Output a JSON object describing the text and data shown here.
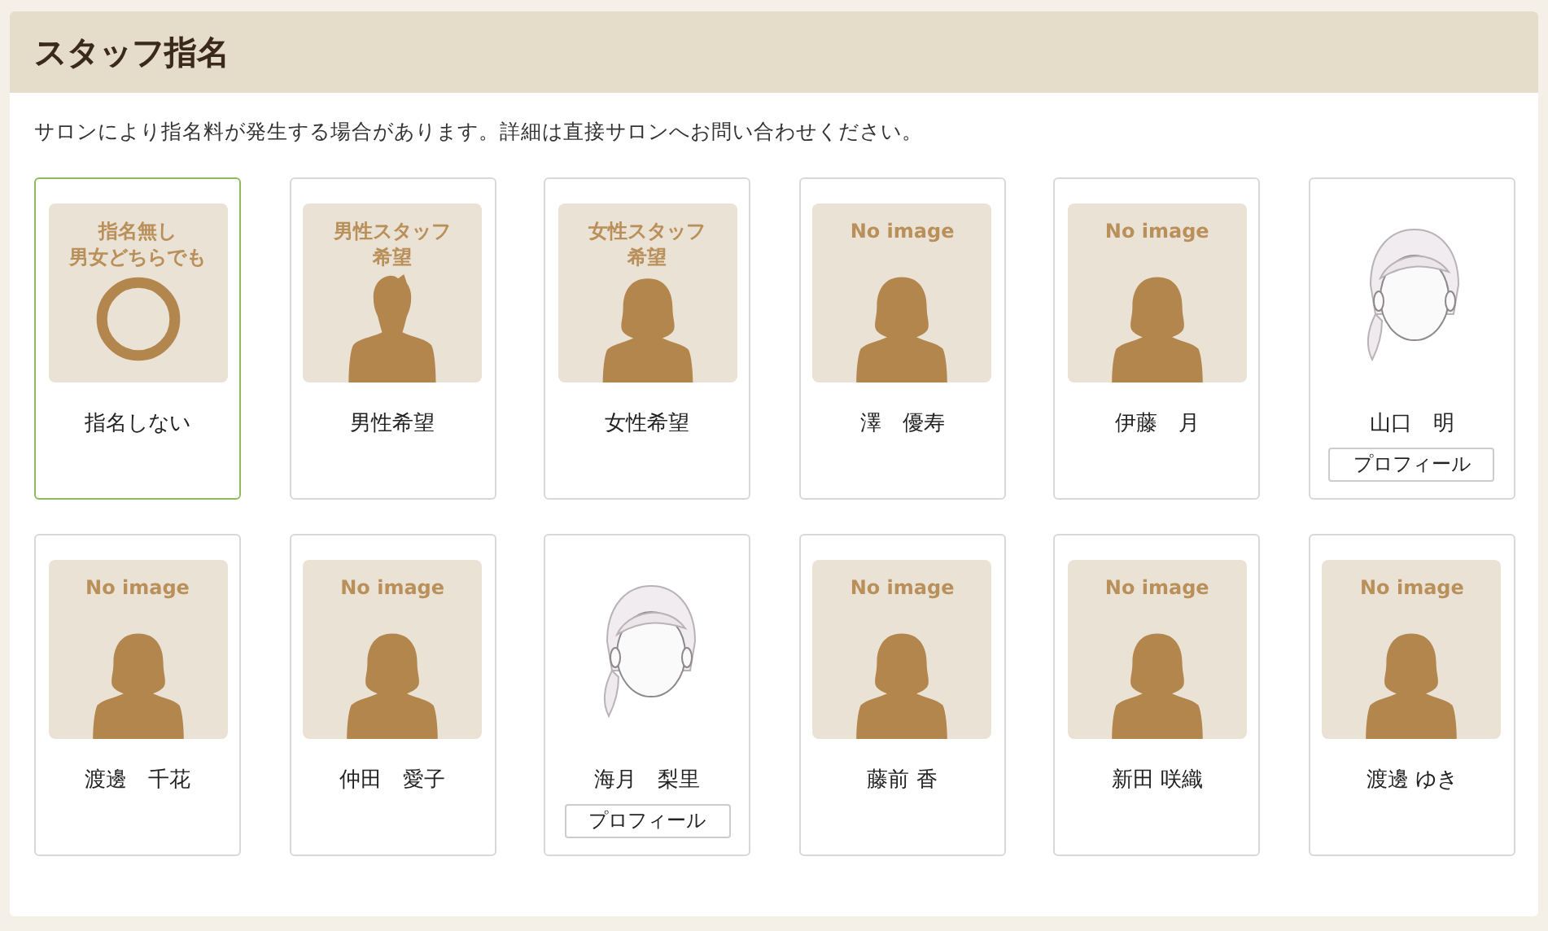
{
  "title": "スタッフ指名",
  "notice": "サロンにより指名料が発生する場合があります。詳細は直接サロンへお問い合わせください。",
  "staff": [
    {
      "image": {
        "kind": "ring",
        "text": [
          "指名無し",
          "男女どちらでも"
        ]
      },
      "name": "指名しない",
      "selected": true
    },
    {
      "image": {
        "kind": "male",
        "text": [
          "男性スタッフ",
          "希望"
        ]
      },
      "name": "男性希望",
      "selected": false
    },
    {
      "image": {
        "kind": "female",
        "text": [
          "女性スタッフ",
          "希望"
        ]
      },
      "name": "女性希望",
      "selected": false
    },
    {
      "image": {
        "kind": "female",
        "text": [
          "No image"
        ]
      },
      "name": "澤　優寿",
      "selected": false
    },
    {
      "image": {
        "kind": "female",
        "text": [
          "No image"
        ]
      },
      "name": "伊藤　月",
      "selected": false
    },
    {
      "name": "山口　明",
      "profile_button": "プロフィール",
      "selected": false
    },
    {
      "image": {
        "kind": "female",
        "text": [
          "No image"
        ]
      },
      "name": "渡邊　千花",
      "selected": false
    },
    {
      "image": {
        "kind": "female",
        "text": [
          "No image"
        ]
      },
      "name": "仲田　愛子",
      "selected": false
    },
    {
      "name": "海月　梨里",
      "profile_button": "プロフィール",
      "selected": false
    },
    {
      "image": {
        "kind": "female",
        "text": [
          "No image"
        ]
      },
      "name": "藤前 香",
      "selected": false
    },
    {
      "image": {
        "kind": "female",
        "text": [
          "No image"
        ]
      },
      "name": "新田 咲織",
      "selected": false
    },
    {
      "image": {
        "kind": "female",
        "text": [
          "No image"
        ]
      },
      "name": "渡邊 ゆき",
      "selected": false
    }
  ]
}
